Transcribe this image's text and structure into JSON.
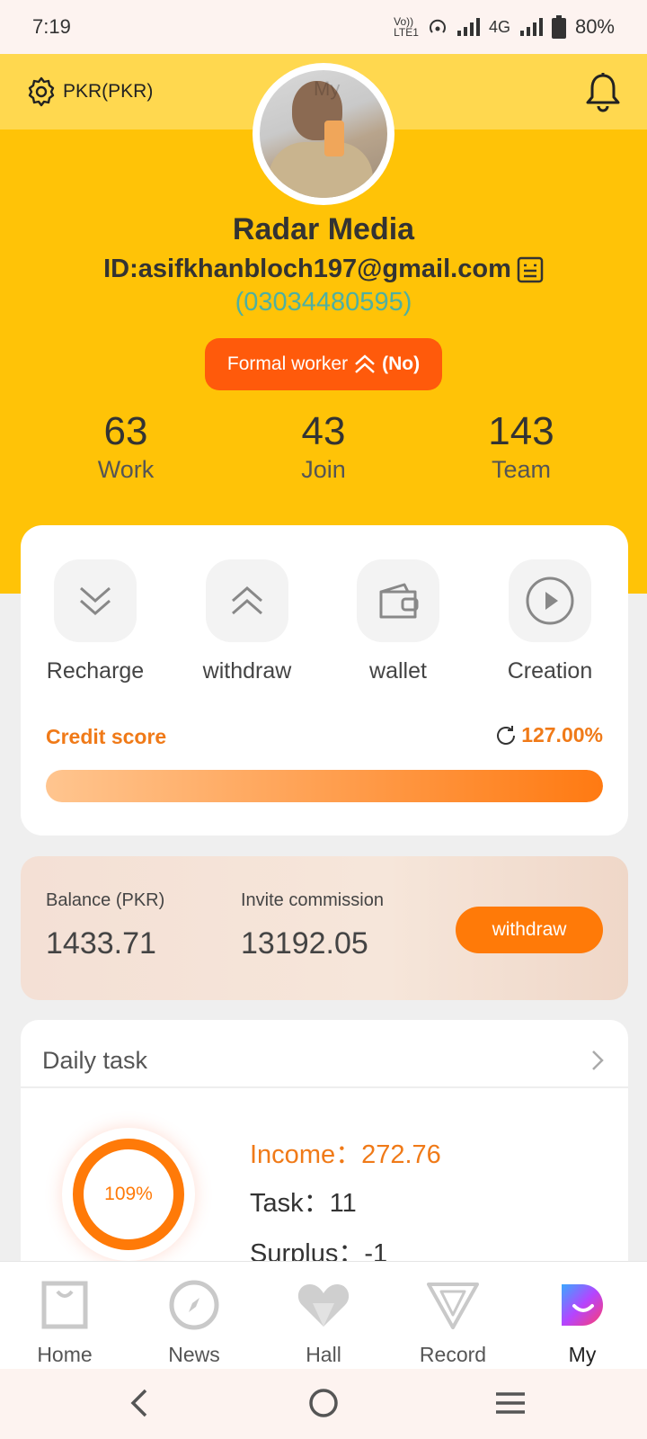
{
  "status_bar": {
    "time": "7:19",
    "network": "4G",
    "battery": "80%"
  },
  "header": {
    "currency": "PKR(PKR)",
    "avatar_watermark": "My",
    "name": "Radar Media",
    "email": "ID:asifkhanbloch197@gmail.com",
    "phone": "(03034480595)",
    "formal_worker_label": "Formal worker",
    "formal_worker_status": "(No)"
  },
  "stats": [
    {
      "value": "63",
      "label": "Work"
    },
    {
      "value": "43",
      "label": "Join"
    },
    {
      "value": "143",
      "label": "Team"
    }
  ],
  "actions": [
    {
      "label": "Recharge",
      "icon": "double-chevron-down-icon"
    },
    {
      "label": "withdraw",
      "icon": "double-chevron-up-icon"
    },
    {
      "label": "wallet",
      "icon": "wallet-icon"
    },
    {
      "label": "Creation",
      "icon": "play-circle-icon"
    }
  ],
  "credit": {
    "label": "Credit score",
    "value": "127.00%",
    "fill_fraction": 1.0
  },
  "balance": {
    "balance_label": "Balance (PKR)",
    "balance_value": "1433.71",
    "commission_label": "Invite commission",
    "commission_value": "13192.05",
    "withdraw_label": "withdraw"
  },
  "daily_task": {
    "title": "Daily task",
    "progress": "109%",
    "income": "Income：272.76",
    "task": "Task：11",
    "surplus": "Surplus：-1"
  },
  "bottom_nav": [
    {
      "label": "Home",
      "icon": "shopping-bag-icon",
      "active": false
    },
    {
      "label": "News",
      "icon": "compass-icon",
      "active": false
    },
    {
      "label": "Hall",
      "icon": "heart-icon",
      "active": false
    },
    {
      "label": "Record",
      "icon": "v-logo-icon",
      "active": false
    },
    {
      "label": "My",
      "icon": "smile-logo-icon",
      "active": true
    }
  ],
  "colors": {
    "header_yellow": "#ffc307",
    "header_top": "#ffd84f",
    "accent_orange": "#ff7a08",
    "formal_orange": "#ff5a0b",
    "phone_teal": "#4eb0a2"
  }
}
